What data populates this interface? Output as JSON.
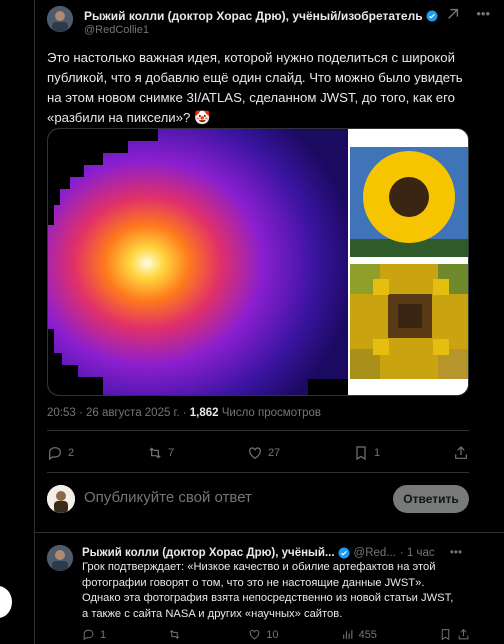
{
  "post": {
    "author_name": "Рыжий колли (доктор Хорас Дрю), учёный/изобретатель",
    "handle": "@RedCollie1",
    "text": "Это настолько важная идея, которой нужно поделиться с широкой публикой, что я добавлю ещё один слайд. Что можно было увидеть на этом новом снимке 3I/ATLAS, сделанном JWST, до того, как его «разбили на пиксели»? 🤡",
    "time": "20:53 · 26 августа 2025 г. · ",
    "views_count": "1,862",
    "views_label": " Число просмотров",
    "replies": "2",
    "reposts": "7",
    "likes": "27",
    "bookmarks": "1"
  },
  "reply_box": {
    "placeholder": "Опубликуйте свой ответ",
    "button": "Ответить"
  },
  "reply": {
    "author_name": "Рыжий колли (доктор Хорас Дрю), учёный...",
    "handle": "@Red...",
    "time": "· 1 час",
    "text": "Грок подтверждает: «Низкое качество и обилие артефактов на этой фотографии говорят о том, что это не настоящие данные JWST». Однако эта фотография взята непосредственно из новой статьи JWST, а также с сайта NASA и других «научных» сайтов.",
    "replies": "1",
    "reposts": "",
    "likes": "10",
    "views": "455"
  },
  "colors": {
    "background": "#000000",
    "text": "#e7e9ea",
    "muted": "#71767b",
    "verified": "#1d9bf0",
    "border": "#2f3336"
  }
}
